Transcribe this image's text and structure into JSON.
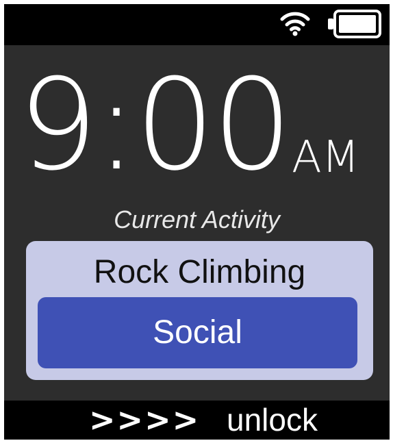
{
  "status_bar": {
    "wifi_icon": "wifi-icon",
    "battery_icon": "battery-full-icon"
  },
  "clock": {
    "time": "9:00",
    "period": "AM"
  },
  "activity": {
    "caption": "Current Activity",
    "name": "Rock Climbing",
    "tag": "Social"
  },
  "unlock": {
    "arrows": ">>>>",
    "label": "unlock"
  },
  "colors": {
    "screen_background": "#2d2d2d",
    "bar_background": "#000000",
    "card_background": "#c7cae7",
    "accent": "#3f51b5",
    "text": "#ffffff"
  }
}
